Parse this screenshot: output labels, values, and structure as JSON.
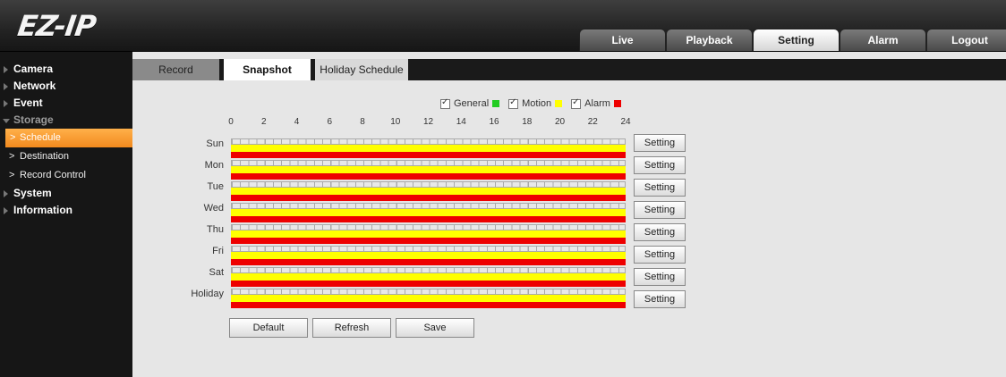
{
  "logo": "EZ-IP",
  "nav": {
    "tabs": [
      {
        "label": "Live"
      },
      {
        "label": "Playback"
      },
      {
        "label": "Setting"
      },
      {
        "label": "Alarm"
      },
      {
        "label": "Logout"
      }
    ],
    "active": "Setting"
  },
  "sidebar": {
    "items": [
      {
        "label": "Camera"
      },
      {
        "label": "Network"
      },
      {
        "label": "Event"
      },
      {
        "label": "Storage"
      },
      {
        "label": "System"
      },
      {
        "label": "Information"
      }
    ],
    "storage_sub": [
      {
        "label": "Schedule"
      },
      {
        "label": "Destination"
      },
      {
        "label": "Record Control"
      }
    ]
  },
  "subtabs": [
    {
      "label": "Record"
    },
    {
      "label": "Snapshot"
    },
    {
      "label": "Holiday Schedule"
    }
  ],
  "legend": {
    "general": "General",
    "motion": "Motion",
    "alarm": "Alarm",
    "general_color": "#22cc22",
    "motion_color": "#ffff00",
    "alarm_color": "#ee0000"
  },
  "hours": [
    "0",
    "2",
    "4",
    "6",
    "8",
    "10",
    "12",
    "14",
    "16",
    "18",
    "20",
    "22",
    "24"
  ],
  "days": [
    "Sun",
    "Mon",
    "Tue",
    "Wed",
    "Thu",
    "Fri",
    "Sat",
    "Holiday"
  ],
  "setting_label": "Setting",
  "buttons": {
    "default": "Default",
    "refresh": "Refresh",
    "save": "Save"
  }
}
